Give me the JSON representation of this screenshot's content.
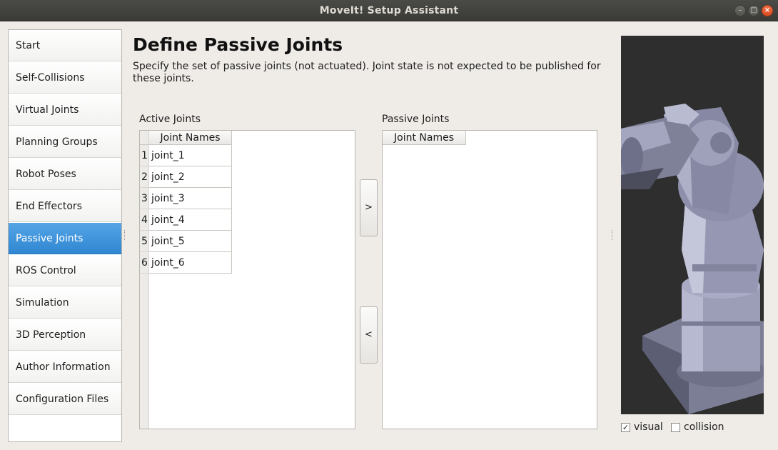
{
  "window": {
    "title": "MoveIt! Setup Assistant",
    "min_glyph": "–",
    "max_glyph": "□",
    "close_glyph": "×"
  },
  "sidebar": {
    "items": [
      {
        "label": "Start",
        "active": false
      },
      {
        "label": "Self-Collisions",
        "active": false
      },
      {
        "label": "Virtual Joints",
        "active": false
      },
      {
        "label": "Planning Groups",
        "active": false
      },
      {
        "label": "Robot Poses",
        "active": false
      },
      {
        "label": "End Effectors",
        "active": false
      },
      {
        "label": "Passive Joints",
        "active": true
      },
      {
        "label": "ROS Control",
        "active": false
      },
      {
        "label": "Simulation",
        "active": false
      },
      {
        "label": "3D Perception",
        "active": false
      },
      {
        "label": "Author Information",
        "active": false
      },
      {
        "label": "Configuration Files",
        "active": false
      }
    ]
  },
  "header": {
    "title": "Define Passive Joints",
    "description": "Specify the set of passive joints (not actuated). Joint state is not expected to be published for these joints."
  },
  "active_joints": {
    "label": "Active Joints",
    "column_header": "Joint Names",
    "rows": [
      {
        "num": "1",
        "name": "joint_1"
      },
      {
        "num": "2",
        "name": "joint_2"
      },
      {
        "num": "3",
        "name": "joint_3"
      },
      {
        "num": "4",
        "name": "joint_4"
      },
      {
        "num": "5",
        "name": "joint_5"
      },
      {
        "num": "6",
        "name": "joint_6"
      }
    ]
  },
  "passive_joints": {
    "label": "Passive Joints",
    "column_header": "Joint Names",
    "rows": []
  },
  "buttons": {
    "move_right": ">",
    "move_left": "<"
  },
  "viewer": {
    "visual_label": "visual",
    "visual_checked": true,
    "collision_label": "collision",
    "collision_checked": false,
    "check_glyph": "✓"
  },
  "colors": {
    "accent": "#3a8fd9",
    "viewport_bg": "#2e2e2e",
    "robot": "#9a9cb6"
  }
}
